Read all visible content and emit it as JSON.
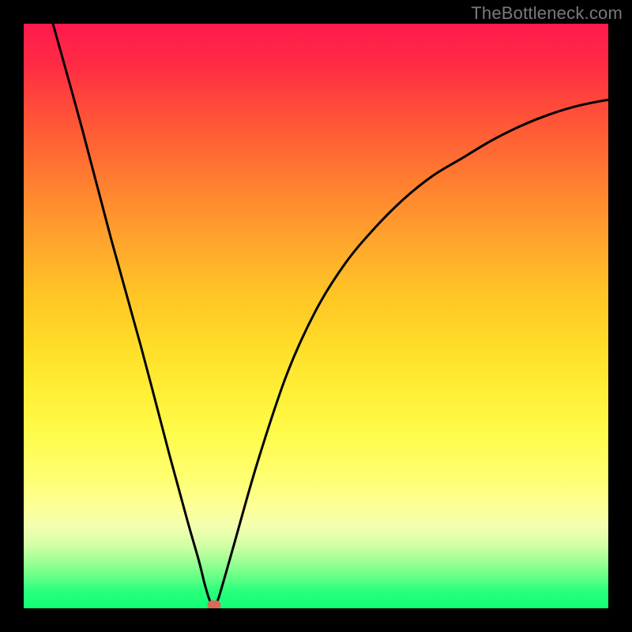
{
  "watermark": "TheBottleneck.com",
  "chart_data": {
    "type": "line",
    "title": "",
    "xlabel": "",
    "ylabel": "",
    "xlim": [
      0,
      100
    ],
    "ylim": [
      0,
      100
    ],
    "grid": false,
    "series": [
      {
        "name": "curve",
        "x": [
          5,
          10,
          15,
          20,
          25,
          28,
          30,
          31,
          32,
          33,
          34,
          36,
          40,
          45,
          50,
          55,
          60,
          65,
          70,
          75,
          80,
          85,
          90,
          95,
          100
        ],
        "values": [
          100,
          82,
          63,
          45,
          26,
          15,
          8,
          4,
          1,
          1,
          4,
          11,
          25,
          40,
          51,
          59,
          65,
          70,
          74,
          77,
          80,
          82.5,
          84.5,
          86,
          87
        ]
      }
    ],
    "marker": {
      "x": 32.5,
      "y": 0.5,
      "color": "#d86a58"
    },
    "background_gradient": [
      "#ff1a4d",
      "#ffc425",
      "#ffff73",
      "#0fff75"
    ]
  }
}
